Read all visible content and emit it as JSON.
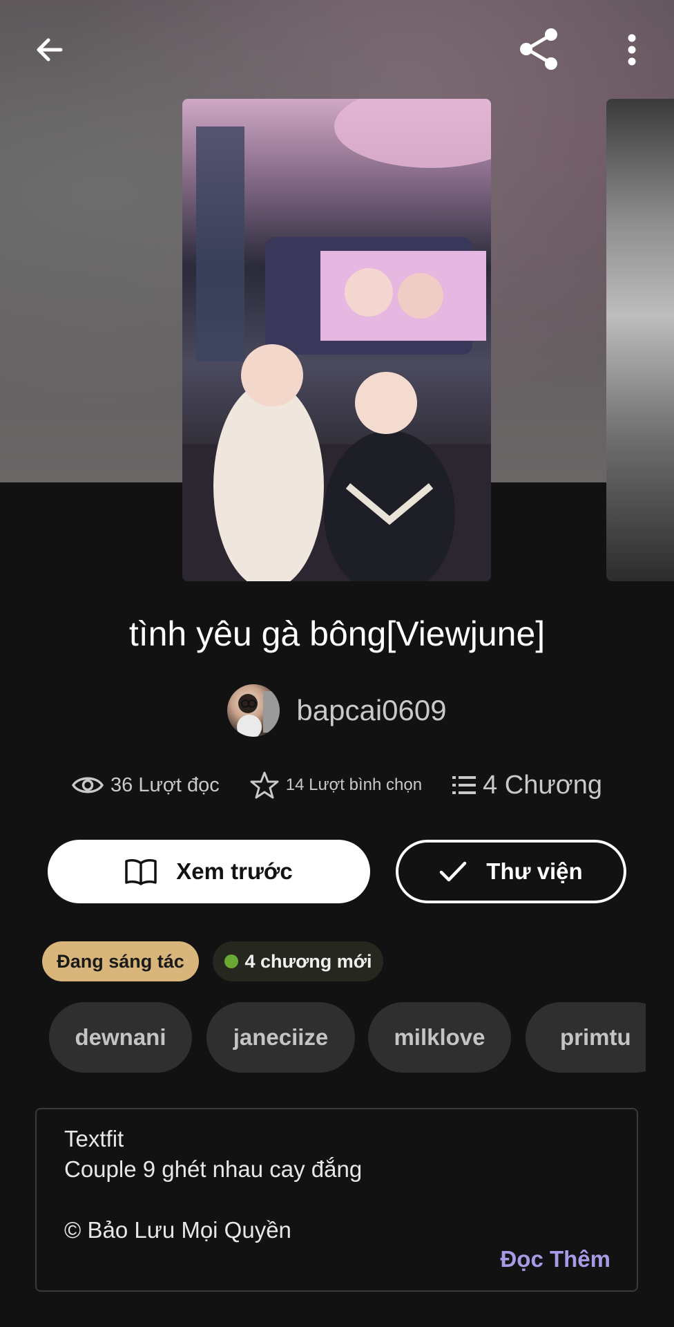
{
  "story": {
    "title": "tình yêu gà bông[Viewjune]",
    "author": "bapcai0609"
  },
  "stats": {
    "reads": "36 Lượt đọc",
    "votes": "14 Lượt bình chọn",
    "chapters": "4 Chương"
  },
  "actions": {
    "preview_label": "Xem trước",
    "library_label": "Thư viện"
  },
  "badges": {
    "status": "Đang sáng tác",
    "new_chapters": "4 chương mới"
  },
  "tags": [
    "dewnani",
    "janeciize",
    "milklove",
    "primtu"
  ],
  "description": {
    "lines": [
      "Textfit",
      "Couple 9 ghét nhau cay đắng",
      "© Bảo Lưu Mọi Quyền"
    ],
    "read_more": "Đọc Thêm"
  },
  "icons": {
    "back": "back-arrow-icon",
    "share": "share-icon",
    "more": "more-vertical-icon",
    "reads": "eye-icon",
    "votes": "star-icon",
    "chapters": "list-icon",
    "preview": "book-open-icon",
    "library": "check-icon"
  },
  "colors": {
    "background": "#121212",
    "status_badge": "#d8b57a",
    "new_dot": "#6aa834",
    "read_more": "#a99ae6"
  }
}
